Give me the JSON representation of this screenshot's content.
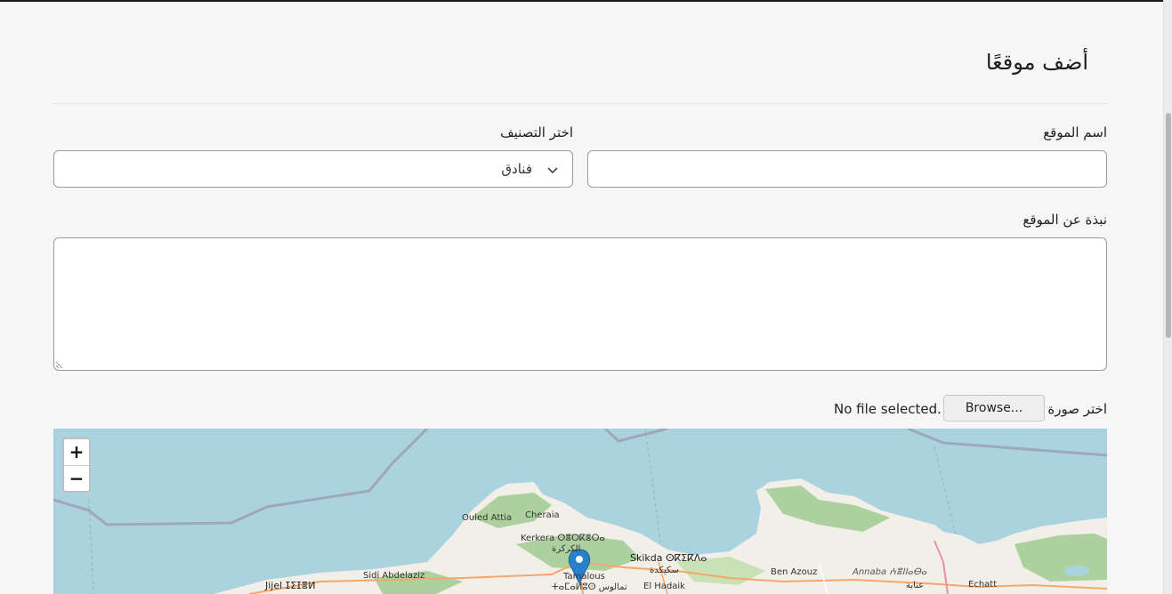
{
  "page": {
    "title": "أضف موقعًا"
  },
  "form": {
    "name_label": "اسم الموقع",
    "name_value": "",
    "category_label": "اختر التصنيف",
    "category_value": "فنادق",
    "about_label": "نبذة عن الموقع",
    "about_value": "",
    "image_label": "اختر صورة",
    "browse_label": "Browse...",
    "file_status": "No file selected."
  },
  "map": {
    "zoom_in": "+",
    "zoom_out": "−",
    "places": {
      "ouled_attia": "Ouled Attia",
      "cheraia": "Cheraia",
      "kerkera": "Kerkera ⵔⴻⵔⴽⴻⵔⴰ",
      "kerkera_ar": "الكركرة",
      "skikda": "Skikda ⵙⴽⵉⴽⴷⴰ",
      "skikda_ar": "سكيكدة",
      "tamalous": "Tamalous",
      "tamalous_ar": "ⵜⴰⵎⴰⵍⵓⵙ تمالوس",
      "el_hadaik": "El Hadaik",
      "ben_azouz": "Ben Azouz",
      "annaba": "Annaba ⵄⴻⵏⵏⴰⴱⴰ",
      "annaba_ar": "عنابة",
      "echatt": "Echatt",
      "sidi_abdelaziz": "Sidi Abdelaziz",
      "jijel": "Jijel ⵊⵉⵊⴻⵍ"
    },
    "colors": {
      "sea": "#aad3df",
      "land": "#f2efe9",
      "forest": "#add19e",
      "border": "#9e9cab",
      "marker": "#2a81cb"
    }
  },
  "icons": {
    "select_chevron": "chevron-down-icon",
    "marker": "map-marker-icon"
  }
}
